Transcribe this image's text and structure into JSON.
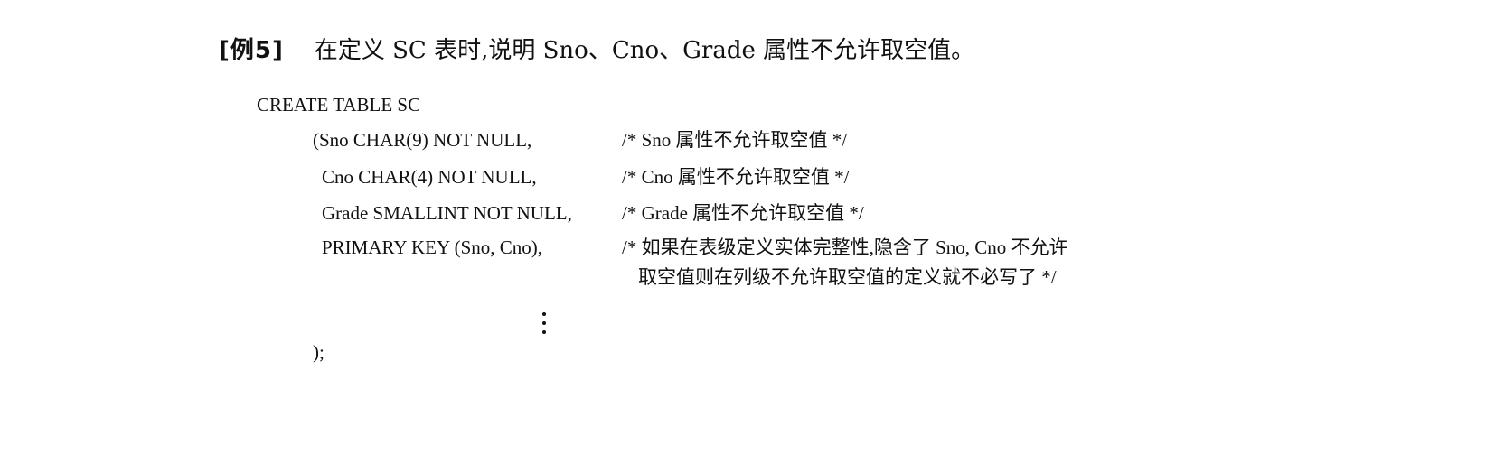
{
  "example": {
    "label": "[例5]",
    "description": "在定义 SC 表时,说明 Sno、Cno、Grade 属性不允许取空值。"
  },
  "code": {
    "create_table": "CREATE TABLE SC",
    "lines": [
      {
        "code": "(Sno CHAR(9) NOT NULL,",
        "comment": "/* Sno 属性不允许取空值 */"
      },
      {
        "code": "Cno CHAR(4) NOT NULL,",
        "comment": "/* Cno 属性不允许取空值 */"
      },
      {
        "code": "Grade SMALLINT NOT NULL,",
        "comment": "/* Grade 属性不允许取空值 */"
      },
      {
        "code": "PRIMARY KEY (Sno, Cno),",
        "comment": "/* 如果在表级定义实体完整性,隐含了 Sno, Cno 不允许",
        "comment_continued": "取空值则在列级不允许取空值的定义就不必写了 */"
      }
    ],
    "closing": ");"
  }
}
